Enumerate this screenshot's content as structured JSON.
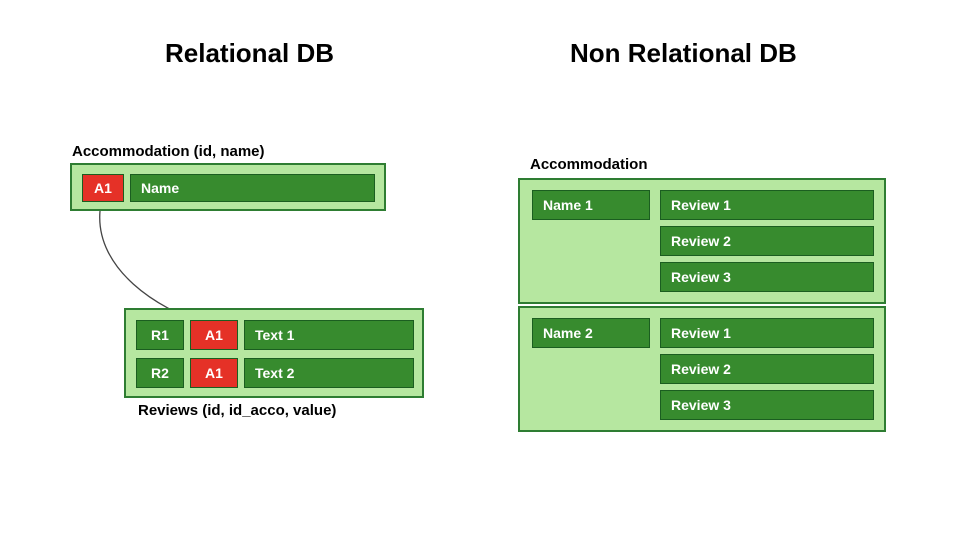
{
  "titles": {
    "left": "Relational DB",
    "right": "Non Relational DB"
  },
  "relational": {
    "accommodation": {
      "label": "Accommodation (id, name)",
      "row": {
        "id": "A1",
        "name": "Name"
      }
    },
    "reviews": {
      "label": "Reviews (id, id_acco, value)",
      "rows": [
        {
          "id": "R1",
          "fk": "A1",
          "value": "Text 1"
        },
        {
          "id": "R2",
          "fk": "A1",
          "value": "Text 2"
        }
      ]
    }
  },
  "nonrelational": {
    "label": "Accommodation",
    "docs": [
      {
        "name": "Name 1",
        "reviews": [
          "Review 1",
          "Review 2",
          "Review 3"
        ]
      },
      {
        "name": "Name 2",
        "reviews": [
          "Review 1",
          "Review 2",
          "Review 3"
        ]
      }
    ]
  }
}
